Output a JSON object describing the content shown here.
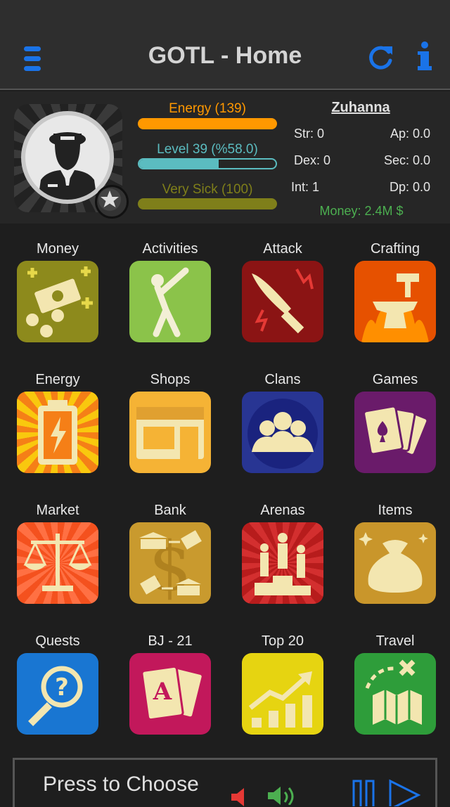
{
  "header": {
    "title": "GOTL - Home",
    "menu_icon": "hamburger-menu-icon",
    "refresh_icon": "refresh-icon",
    "info_icon": "info-icon",
    "accent": "#1a73e8"
  },
  "profile": {
    "username": "Zuhanna",
    "energy": {
      "label": "Energy (139)",
      "fraction": 1.0,
      "color": "#ff9800"
    },
    "level": {
      "label": "Level 39 (%58.0)",
      "fraction": 0.58,
      "color": "#5bbcc0"
    },
    "health": {
      "label": "Very Sick (100)",
      "fraction": 1.0,
      "color": "#7f7f1a"
    },
    "stats": {
      "str": "Str: 0",
      "dex": "Dex: 0",
      "int": "Int: 1",
      "ap": "Ap: 0.0",
      "sec": "Sec: 0.0",
      "dp": "Dp: 0.0"
    },
    "money": "Money: 2.4M $"
  },
  "grid": [
    {
      "label": "Money",
      "icon": "money-icon",
      "bg": "#8d8a1c"
    },
    {
      "label": "Activities",
      "icon": "activities-icon",
      "bg": "#8bc34a"
    },
    {
      "label": "Attack",
      "icon": "knife-attack-icon",
      "bg": "#8b1414"
    },
    {
      "label": "Crafting",
      "icon": "anvil-hammer-icon",
      "bg": "#e65100"
    },
    {
      "label": "Energy",
      "icon": "battery-energy-icon",
      "bg": "#f9c80e"
    },
    {
      "label": "Shops",
      "icon": "storefront-icon",
      "bg": "#f5b335"
    },
    {
      "label": "Clans",
      "icon": "clan-group-icon",
      "bg": "#283593"
    },
    {
      "label": "Games",
      "icon": "playing-cards-icon",
      "bg": "#6a1b6a"
    },
    {
      "label": "Market",
      "icon": "balance-scale-icon",
      "bg": "#f4511e"
    },
    {
      "label": "Bank",
      "icon": "bank-exchange-icon",
      "bg": "#c99a2e"
    },
    {
      "label": "Arenas",
      "icon": "podium-icon",
      "bg": "#d32f2f"
    },
    {
      "label": "Items",
      "icon": "sack-icon",
      "bg": "#c9962b"
    },
    {
      "label": "Quests",
      "icon": "magnifier-question-icon",
      "bg": "#1976d2"
    },
    {
      "label": "BJ - 21",
      "icon": "ace-card-icon",
      "bg": "#c2185b"
    },
    {
      "label": "Top 20",
      "icon": "growth-chart-icon",
      "bg": "#e6d411"
    },
    {
      "label": "Travel",
      "icon": "treasure-map-icon",
      "bg": "#2e9d3a"
    }
  ],
  "bottom": {
    "choose_label": "Press to Choose",
    "mute_icon": "speaker-mute-icon",
    "sound_icon": "speaker-sound-icon",
    "pause_icon": "pause-icon",
    "play_icon": "play-icon"
  }
}
